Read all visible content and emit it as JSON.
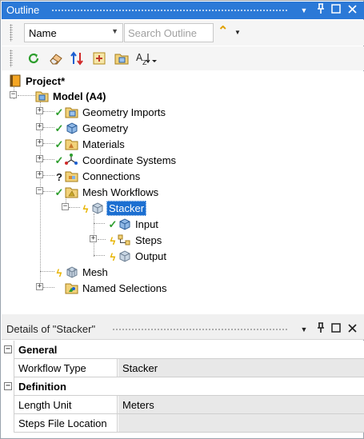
{
  "outline": {
    "title": "Outline",
    "controls": {
      "dropdown": "▼",
      "pin": "Ꝗ",
      "restore": "☐",
      "close": "✕"
    },
    "filter": {
      "name_value": "Name",
      "search_placeholder": "Search Outline"
    }
  },
  "tree": {
    "root": "Project*",
    "model": "Model (A4)",
    "items": [
      {
        "label": "Geometry Imports",
        "icon": "geometry-imports-icon",
        "status": "check"
      },
      {
        "label": "Geometry",
        "icon": "geometry-icon",
        "status": "check"
      },
      {
        "label": "Materials",
        "icon": "materials-icon",
        "status": "check"
      },
      {
        "label": "Coordinate Systems",
        "icon": "coordinate-systems-icon",
        "status": "check"
      },
      {
        "label": "Connections",
        "icon": "connections-icon",
        "status": "question"
      },
      {
        "label": "Mesh Workflows",
        "icon": "mesh-workflows-icon",
        "status": "check"
      },
      {
        "label": "Stacker",
        "icon": "stacker-icon",
        "status": "lightning"
      },
      {
        "label": "Input",
        "icon": "input-icon",
        "status": "check"
      },
      {
        "label": "Steps",
        "icon": "steps-icon",
        "status": "lightning"
      },
      {
        "label": "Output",
        "icon": "output-icon",
        "status": "lightning"
      },
      {
        "label": "Mesh",
        "icon": "mesh-icon",
        "status": "lightning"
      },
      {
        "label": "Named Selections",
        "icon": "named-selections-icon",
        "status": "none"
      }
    ]
  },
  "details": {
    "title": "Details of \"Stacker\"",
    "groups": [
      {
        "label": "General",
        "rows": [
          {
            "name": "Workflow Type",
            "value": "Stacker"
          }
        ]
      },
      {
        "label": "Definition",
        "rows": [
          {
            "name": "Length Unit",
            "value": "Meters"
          },
          {
            "name": "Steps File Location",
            "value": ""
          }
        ]
      }
    ]
  },
  "colors": {
    "title_bar": "#2b79d7",
    "selection": "#1c6fd1",
    "check": "#2e9e2e",
    "lightning": "#e8b400",
    "value_bg": "#e8e8e8"
  }
}
